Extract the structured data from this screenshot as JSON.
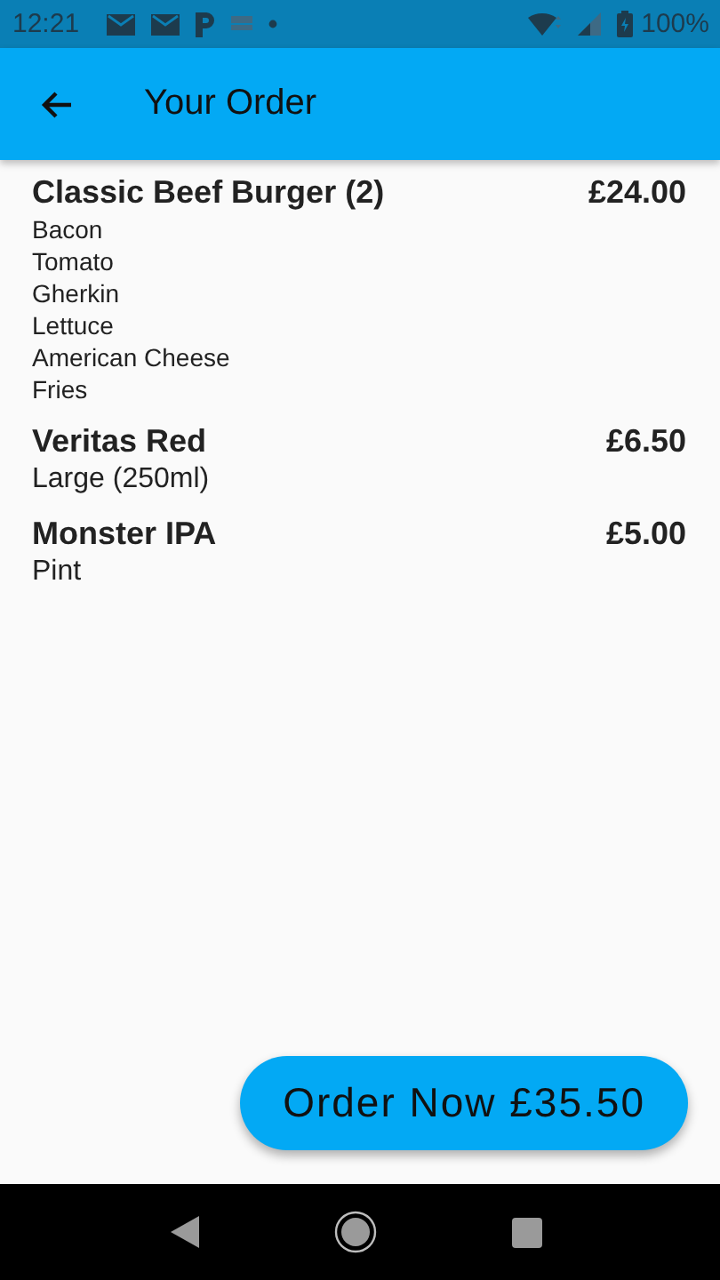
{
  "status_bar": {
    "time": "12:21",
    "battery": "100%"
  },
  "app_bar": {
    "title": "Your Order"
  },
  "items": [
    {
      "name": "Classic Beef Burger (2)",
      "price": "£24.00",
      "kind": "extras",
      "details": [
        "Bacon",
        "Tomato",
        "Gherkin",
        "Lettuce",
        "American Cheese",
        "Fries"
      ]
    },
    {
      "name": "Veritas Red",
      "price": "£6.50",
      "kind": "variant",
      "details": [
        "Large (250ml)"
      ]
    },
    {
      "name": "Monster IPA",
      "price": "£5.00",
      "kind": "variant",
      "details": [
        "Pint"
      ]
    }
  ],
  "order_button": {
    "label": "Order Now £35.50"
  }
}
